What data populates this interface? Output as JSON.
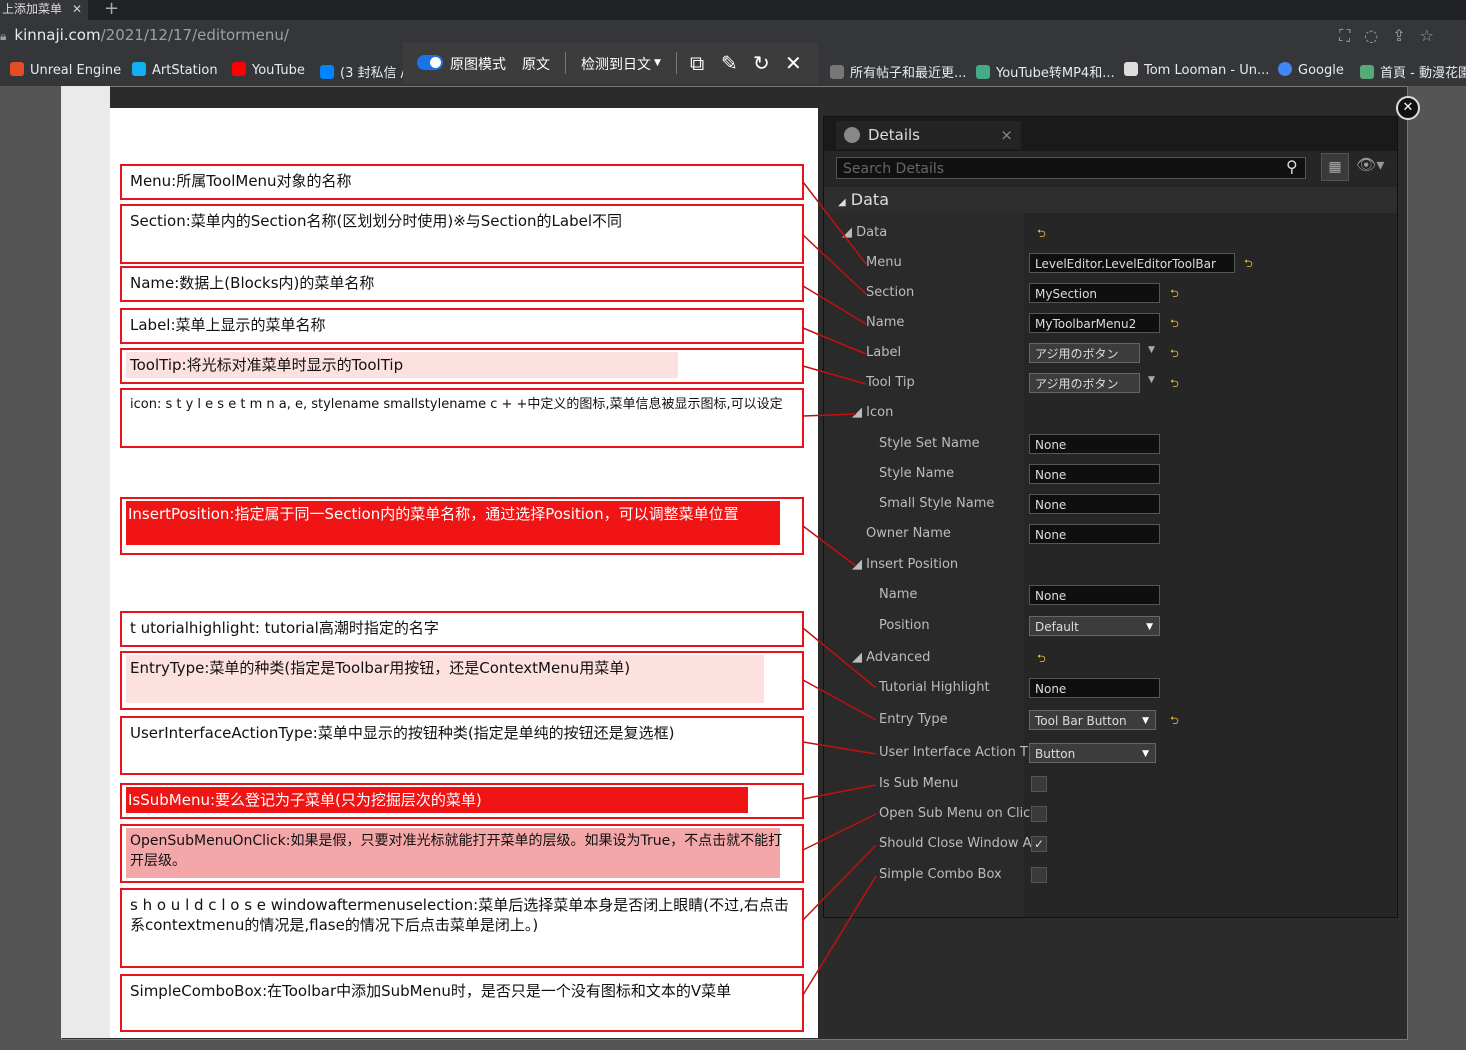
{
  "browser": {
    "tab_title": "上添加菜单",
    "url_domain": "kinnaji.com",
    "url_path": "/2021/12/17/editormenu/",
    "bookmarks": [
      {
        "label": "Unreal Engine",
        "color": "#e44d26"
      },
      {
        "label": "ArtStation",
        "color": "#13aff0"
      },
      {
        "label": "YouTube",
        "color": "#ff0000"
      },
      {
        "label": "(3 封私信 /",
        "color": "#0084ff"
      },
      {
        "label": "所有帖子和最近更...",
        "color": "#777"
      },
      {
        "label": "YouTube转MP4和...",
        "color": "#4a8"
      },
      {
        "label": "Tom Looman - Un...",
        "color": "#ddd"
      },
      {
        "label": "Google",
        "color": "#4285f4"
      },
      {
        "label": "首頁 - 動漫花園",
        "color": "#5a7"
      }
    ]
  },
  "translate_bar": {
    "mode_label": "原图模式",
    "original_label": "原文",
    "detect_label": "检测到日文",
    "copy_icon": "copy-icon",
    "edit_icon": "edit-icon",
    "refresh_icon": "refresh-icon",
    "close_icon": "close-icon"
  },
  "annotations": [
    {
      "text": "Menu:所属ToolMenu对象的名称"
    },
    {
      "text": "Section:菜单内的Section名称(区划划分时使用)※与Section的Label不同"
    },
    {
      "text": "Name:数据上(Blocks内)的菜单名称"
    },
    {
      "text": "Label:菜单上显示的菜单名称"
    },
    {
      "text": "ToolTip:将光标对准菜单时显示的ToolTip"
    },
    {
      "text": "icon: s t y l e s e t m n a, e, stylename smallstylename c + +中定义的图标,菜单信息被显示图标,可以设定"
    },
    {
      "text": "InsertPosition:指定属于同一Section内的菜单名称，通过选择Position，可以调整菜单位置"
    },
    {
      "text": "t utorialhighlight: tutorial高潮时指定的名字"
    },
    {
      "text": "EntryType:菜单的种类(指定是Toolbar用按钮，还是ContextMenu用菜单)"
    },
    {
      "text": "UserInterfaceActionType:菜单中显示的按钮种类(指定是单纯的按钮还是复选框)"
    },
    {
      "text": "IsSubMenu:要么登记为子菜单(只为挖掘层次的菜单)"
    },
    {
      "text": "OpenSubMenuOnClick:如果是假，只要对准光标就能打开菜单的层级。如果设为True，不点击就不能打开层级。"
    },
    {
      "text": "s h o u l d c l o s e windowaftermenuselection:菜单后选择菜单本身是否闭上眼睛(不过,右点击系contextmenu的情况是,flase的情况下后点击菜单是闭上。)"
    },
    {
      "text": "SimpleComboBox:在Toolbar中添加SubMenu时，是否只是一个没有图标和文本的V菜单"
    }
  ],
  "details": {
    "tab_label": "Details",
    "search_placeholder": "Search Details",
    "category": "Data",
    "props": {
      "data": "Data",
      "menu": "Menu",
      "menu_val": "LevelEditor.LevelEditorToolBar",
      "section": "Section",
      "section_val": "MySection",
      "name": "Name",
      "name_val": "MyToolbarMenu2",
      "label": "Label",
      "label_val": "アジ用のボタン",
      "tooltip": "Tool Tip",
      "tooltip_val": "アジ用のボタン",
      "icon": "Icon",
      "style_set_name": "Style Set Name",
      "style_set_val": "None",
      "style_name": "Style Name",
      "style_name_val": "None",
      "small_style_name": "Small Style Name",
      "small_style_val": "None",
      "owner_name": "Owner Name",
      "owner_val": "None",
      "insert_position": "Insert Position",
      "ip_name": "Name",
      "ip_name_val": "None",
      "ip_position": "Position",
      "ip_position_val": "Default",
      "advanced": "Advanced",
      "tutorial_highlight": "Tutorial Highlight",
      "tutorial_val": "None",
      "entry_type": "Entry Type",
      "entry_type_val": "Tool Bar Button",
      "ui_action_type": "User Interface Action T",
      "ui_action_val": "Button",
      "is_sub_menu": "Is Sub Menu",
      "open_sub_menu": "Open Sub Menu on Clic",
      "should_close": "Should Close Window A",
      "simple_combo": "Simple Combo Box"
    }
  }
}
